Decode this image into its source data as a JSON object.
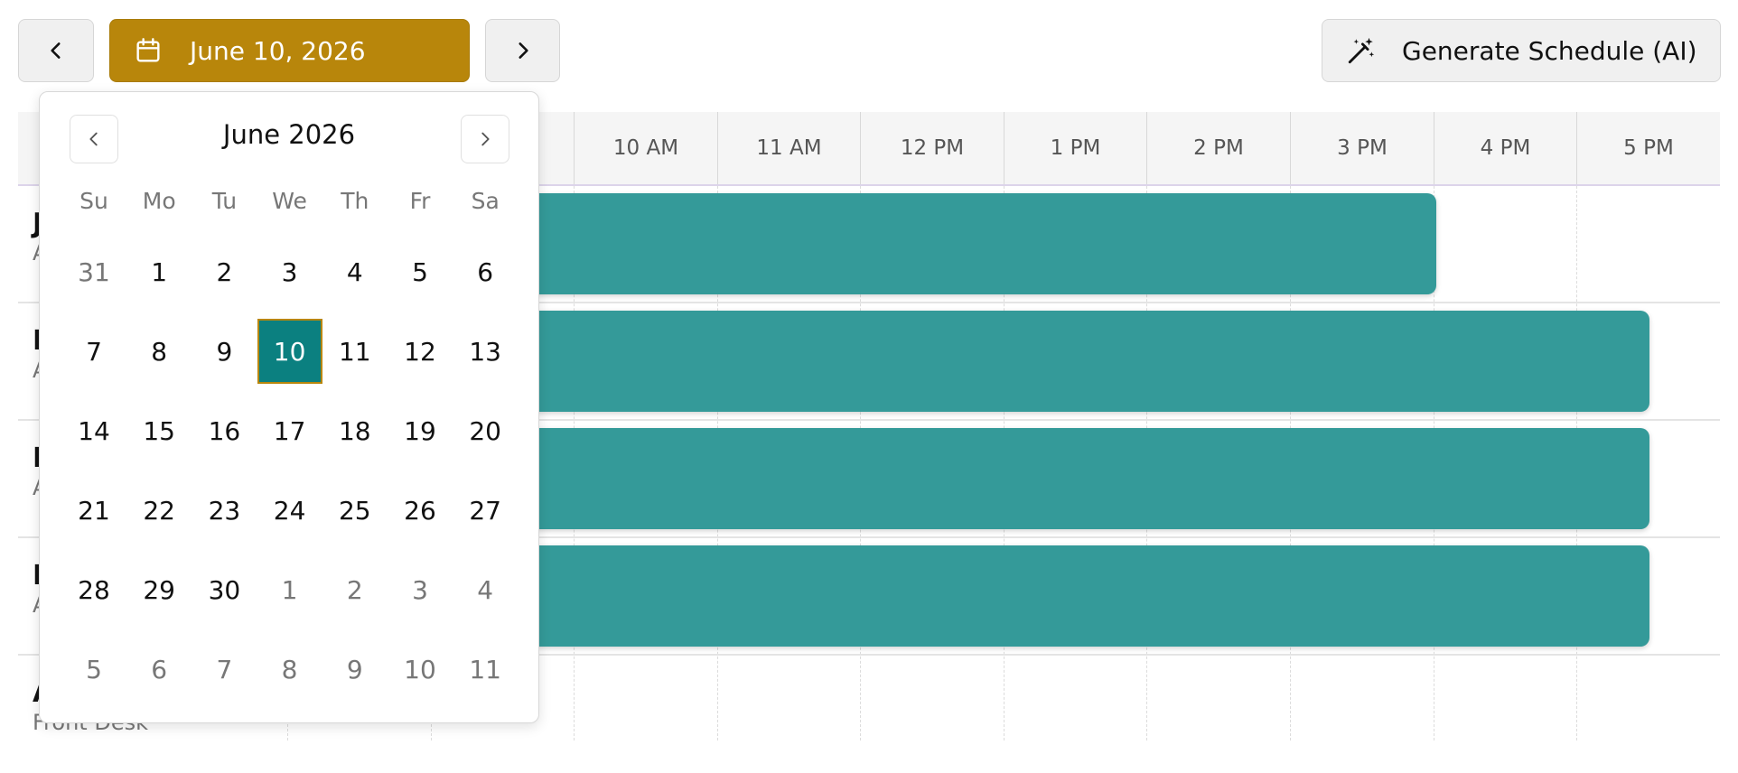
{
  "toolbar": {
    "selected_date": "June 10, 2026",
    "generate_label": "Generate Schedule (AI)",
    "accent_color": "#b8860b"
  },
  "timeline": {
    "hours": [
      "10 AM",
      "11 AM",
      "12 PM",
      "1 PM",
      "2 PM",
      "3 PM",
      "4 PM",
      "5 PM"
    ],
    "rows": [
      {
        "name": "J",
        "role": "A"
      },
      {
        "name": "I",
        "role": "A"
      },
      {
        "name": "I",
        "role": "A"
      },
      {
        "name": "I",
        "role": "A"
      },
      {
        "name": "A",
        "role": "Front Desk"
      }
    ],
    "shift_color": "#349a99"
  },
  "calendar": {
    "month_title": "June 2026",
    "weekdays": [
      "Su",
      "Mo",
      "Tu",
      "We",
      "Th",
      "Fr",
      "Sa"
    ],
    "weeks": [
      [
        "31",
        "1",
        "2",
        "3",
        "4",
        "5",
        "6"
      ],
      [
        "7",
        "8",
        "9",
        "10",
        "11",
        "12",
        "13"
      ],
      [
        "14",
        "15",
        "16",
        "17",
        "18",
        "19",
        "20"
      ],
      [
        "21",
        "22",
        "23",
        "24",
        "25",
        "26",
        "27"
      ],
      [
        "28",
        "29",
        "30",
        "1",
        "2",
        "3",
        "4"
      ],
      [
        "5",
        "6",
        "7",
        "8",
        "9",
        "10",
        "11"
      ]
    ],
    "selected_day": "10",
    "selected_color": "#0b8080"
  }
}
